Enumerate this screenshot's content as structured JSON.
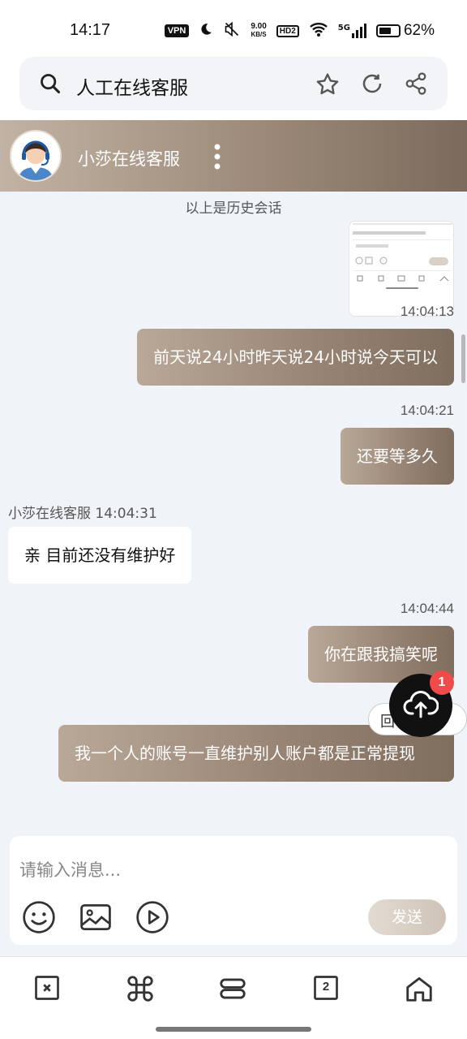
{
  "status_bar": {
    "time": "14:17",
    "vpn": "VPN",
    "speed_value": "9.00",
    "speed_unit": "KB/S",
    "hd": "HD2",
    "network": "5G",
    "battery_level": 0.62,
    "battery_text": "62%"
  },
  "search": {
    "query": "人工在线客服",
    "icons": [
      "search-icon",
      "star-icon",
      "refresh-icon",
      "share-icon"
    ]
  },
  "chat_header": {
    "title": "小莎在线客服",
    "icons": [
      "avatar",
      "more-icon"
    ]
  },
  "chat": {
    "history_label": "以上是历史会话",
    "messages": [
      {
        "type": "image",
        "direction": "out"
      },
      {
        "type": "time",
        "text": "14:04:13"
      },
      {
        "type": "text",
        "direction": "out",
        "text": "前天说24小时昨天说24小时说今天可以"
      },
      {
        "type": "time",
        "text": "14:04:21"
      },
      {
        "type": "text",
        "direction": "out",
        "text": "还要等多久"
      },
      {
        "type": "sender",
        "text": "小莎在线客服 14:04:31"
      },
      {
        "type": "text",
        "direction": "in",
        "text": "亲 目前还没有维护好"
      },
      {
        "type": "time",
        "text": "14:04:44"
      },
      {
        "type": "text",
        "direction": "out",
        "text": "你在跟我搞笑呢"
      },
      {
        "type": "text",
        "direction": "out",
        "text": "我一个人的账号一直维护别人账户都是正常提现"
      }
    ]
  },
  "floating": {
    "pill_text": "回",
    "badge_count": "1",
    "fab_icon": "cloud-upload-icon"
  },
  "composer": {
    "placeholder": "请输入消息...",
    "send_label": "发送",
    "tools": [
      "emoji-icon",
      "image-icon",
      "video-icon"
    ]
  },
  "bottom_nav": {
    "tab_count": "2",
    "items": [
      "close-tab-icon",
      "command-icon",
      "menu-icon",
      "tabs-icon",
      "home-icon"
    ]
  },
  "colors": {
    "header_gradient": [
      "#c1b3a4",
      "#7c6b5d"
    ],
    "background": "#f0f3f7",
    "badge": "#f04b4b"
  }
}
